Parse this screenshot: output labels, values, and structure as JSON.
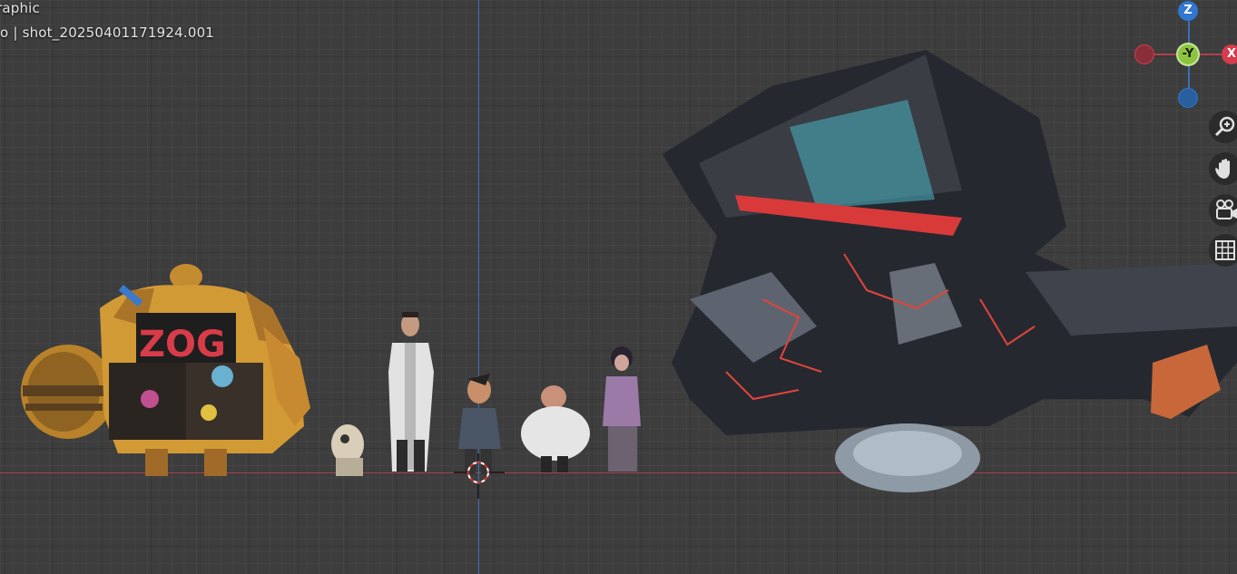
{
  "viewport": {
    "title": "raphic",
    "info": "o | shot_20250401171924.001"
  },
  "gizmo": {
    "z_label": "Z",
    "y_label": "-Y",
    "x_label": "X",
    "colors": {
      "x": "#d63c4d",
      "y": "#8bc53f",
      "z": "#2f77d0",
      "x_neg": "#8a2f3a",
      "z_neg": "#2a5f9e"
    }
  },
  "navigation": {
    "zoom_icon": "zoom-icon",
    "pan_icon": "hand-icon",
    "camera_icon": "camera-icon",
    "grid_icon": "grid-icon"
  },
  "axis_colors": {
    "x_axis": "#a8414c",
    "z_axis": "#3f6eb8"
  }
}
